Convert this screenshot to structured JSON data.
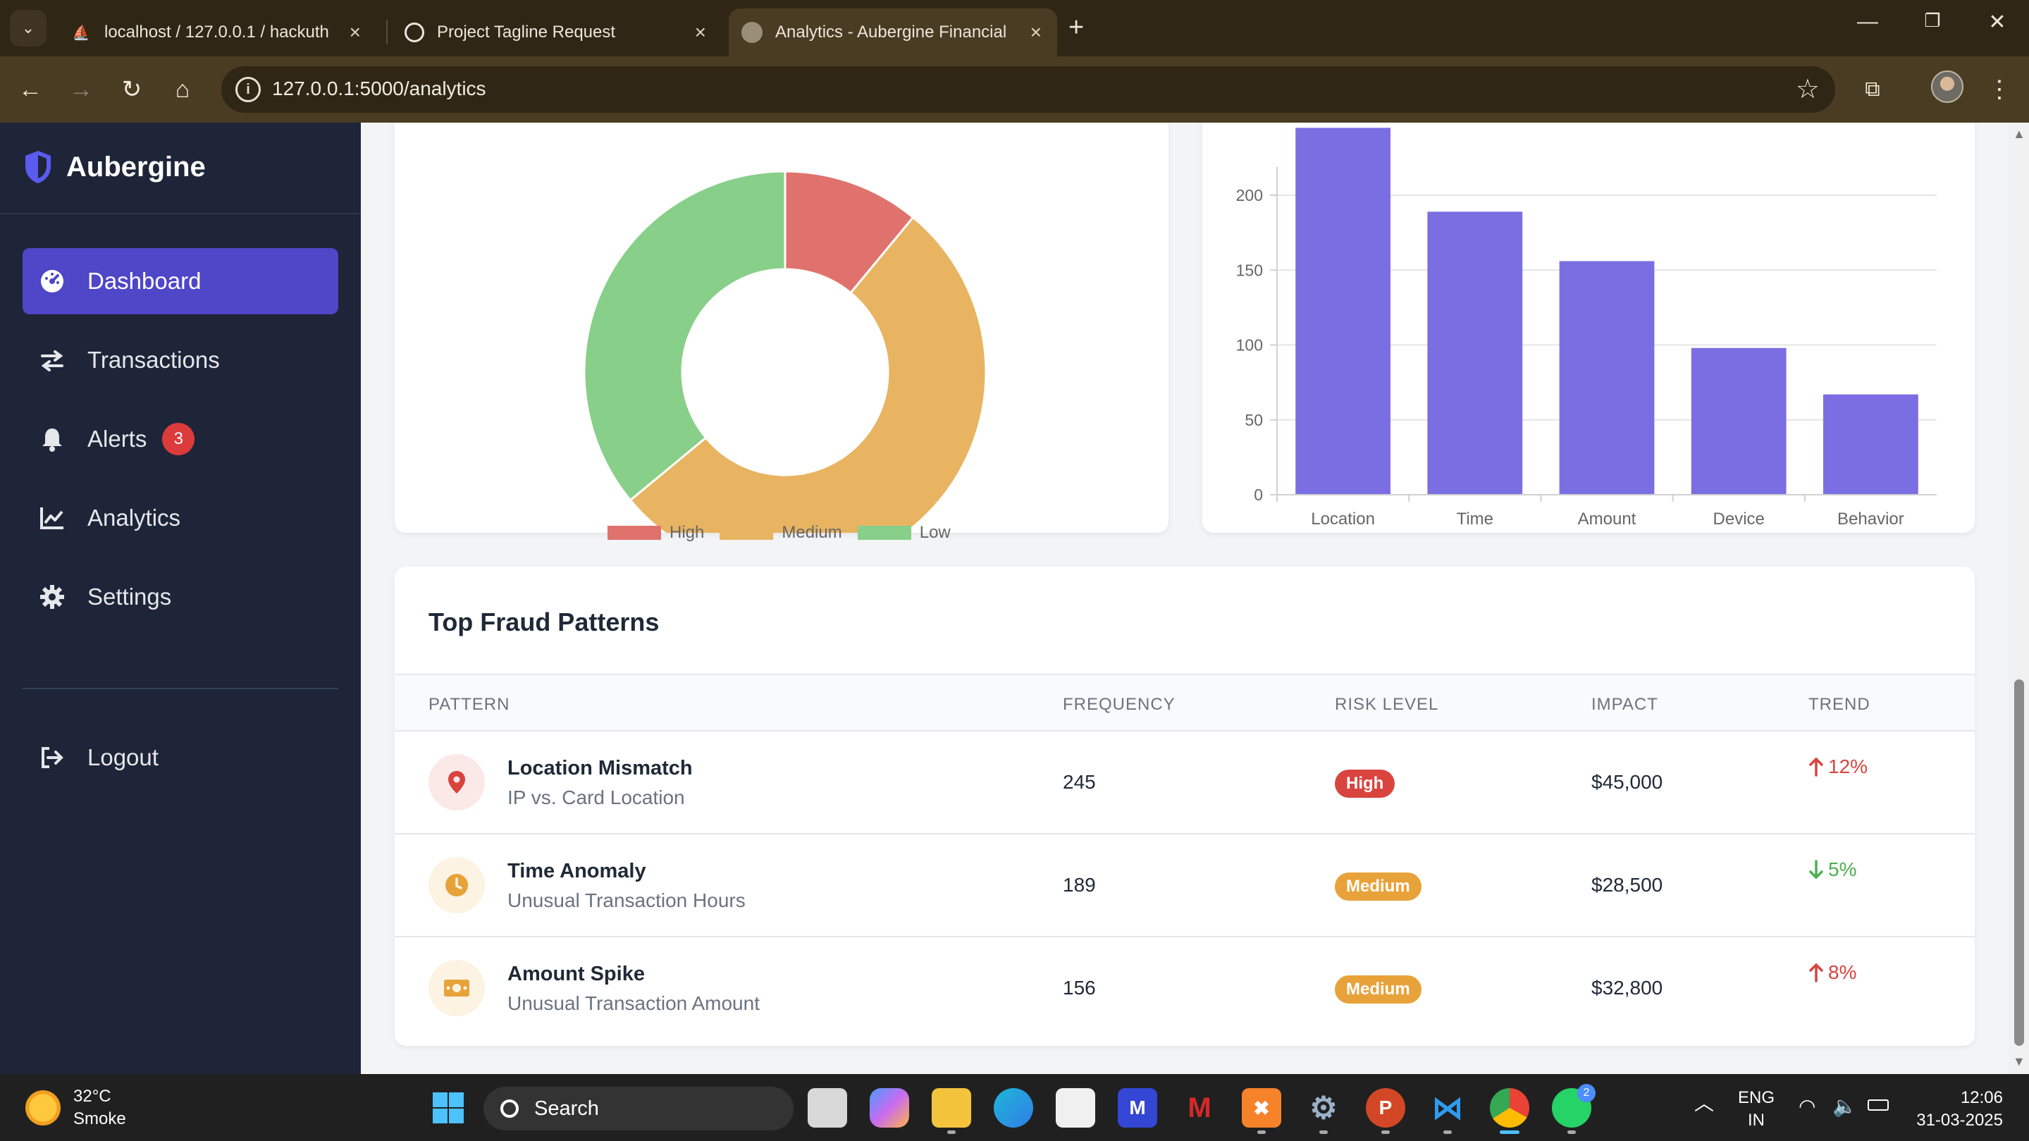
{
  "browser": {
    "tabs": [
      {
        "title": "localhost / 127.0.0.1 / hackuth",
        "icon": "phpmyadmin-icon",
        "active": false
      },
      {
        "title": "Project Tagline Request",
        "icon": "chatgpt-icon",
        "active": false
      },
      {
        "title": "Analytics - Aubergine Financial",
        "icon": "globe-icon",
        "active": true
      }
    ],
    "url": "127.0.0.1:5000/analytics"
  },
  "sidebar": {
    "brand": "Aubergine",
    "items": [
      {
        "label": "Dashboard",
        "icon": "gauge-icon",
        "active": true
      },
      {
        "label": "Transactions",
        "icon": "exchange-icon"
      },
      {
        "label": "Alerts",
        "icon": "bell-icon",
        "badge": "3"
      },
      {
        "label": "Analytics",
        "icon": "chart-line-icon"
      },
      {
        "label": "Settings",
        "icon": "gear-icon"
      }
    ],
    "logout": "Logout"
  },
  "donut_chart": {
    "chart_data": {
      "type": "pie",
      "categories": [
        "High",
        "Medium",
        "Low"
      ],
      "values": [
        11,
        53,
        36
      ],
      "colors": [
        "#e0726d",
        "#e8b461",
        "#88cf89"
      ],
      "legend": "bottom"
    }
  },
  "bar_chart": {
    "chart_data": {
      "type": "bar",
      "categories": [
        "Location",
        "Time",
        "Amount",
        "Device",
        "Behavior"
      ],
      "values": [
        245,
        189,
        156,
        98,
        67
      ],
      "yticks": [
        "0",
        "50",
        "100",
        "150",
        "200"
      ],
      "ylim": [
        0,
        200
      ],
      "color": "#7b6ee3",
      "grid": true
    }
  },
  "table": {
    "title": "Top Fraud Patterns",
    "headers": [
      "PATTERN",
      "FREQUENCY",
      "RISK LEVEL",
      "IMPACT",
      "TREND"
    ],
    "rows": [
      {
        "name": "Location Mismatch",
        "sub": "IP vs. Card Location",
        "icon": "map-pin-icon",
        "frequency": "245",
        "risk": "High",
        "impact": "$45,000",
        "trend": "12%",
        "trend_dir": "up"
      },
      {
        "name": "Time Anomaly",
        "sub": "Unusual Transaction Hours",
        "icon": "clock-icon",
        "frequency": "189",
        "risk": "Medium",
        "impact": "$28,500",
        "trend": "5%",
        "trend_dir": "down"
      },
      {
        "name": "Amount Spike",
        "sub": "Unusual Transaction Amount",
        "icon": "money-bill-icon",
        "frequency": "156",
        "risk": "Medium",
        "impact": "$32,800",
        "trend": "8%",
        "trend_dir": "up"
      }
    ],
    "colors": {
      "high": "#d9443f",
      "medium": "#e8a23a",
      "up": "#d9443f",
      "down": "#4caf50"
    }
  },
  "taskbar": {
    "weather_temp": "32°C",
    "weather_desc": "Smoke",
    "search": "Search",
    "lang_line1": "ENG",
    "lang_line2": "IN",
    "time": "12:06",
    "date": "31-03-2025",
    "whatsapp_badge": "2"
  }
}
